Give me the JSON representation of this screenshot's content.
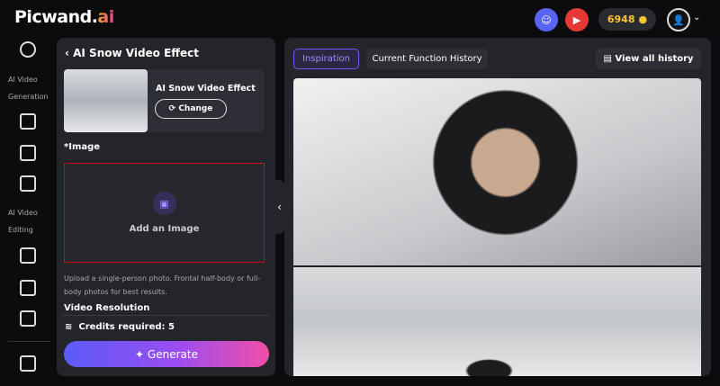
{
  "header": {
    "logo_main": "Picwand.",
    "logo_accent": "ai",
    "credits": "6948",
    "icons": [
      "discord-icon",
      "youtube-icon",
      "coin-icon",
      "avatar-icon",
      "chevron-down-icon"
    ]
  },
  "sidebar": {
    "section1": "AI Video Generation",
    "section2": "AI Video Editing"
  },
  "left": {
    "title": "AI Snow Video Effect",
    "effect_name": "AI Snow Video Effect",
    "change": "Change",
    "image_label": "*Image",
    "add_image": "Add an Image",
    "hint": "Upload a single-person photo. Frontal half-body or full-body photos for best results.",
    "resolution": "Video Resolution",
    "credits_label": "Credits required:",
    "credits_value": "5",
    "generate": "Generate"
  },
  "right": {
    "tabs": [
      "Inspiration",
      "Current Function History"
    ],
    "view_all": "View all history"
  },
  "colors": {
    "accent": "#6b5cf6",
    "generate_start": "#5a5cf7",
    "generate_end": "#f04fa8",
    "credits": "#f7c531",
    "upload_border": "#d0021b"
  }
}
